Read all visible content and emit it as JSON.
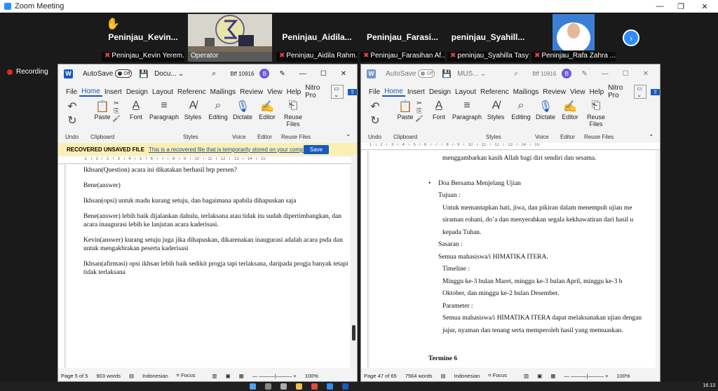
{
  "zoom": {
    "window_title": "Zoom Meeting",
    "recording_label": "Recording",
    "participants": [
      {
        "name": "Peninjau_Kevin...",
        "label": "Peninjau_Kevin Yerem...",
        "muted": true
      },
      {
        "name": "",
        "label": "Operator",
        "muted": false
      },
      {
        "name": "Peninjau_Aidila...",
        "label": "Peninjau_Aidila Rahm...",
        "muted": true
      },
      {
        "name": "Peninjau_Farasi...",
        "label": "Peninjau_Farasihan Af...",
        "muted": true
      },
      {
        "name": "peninjau_Syahill...",
        "label": "peninjau_Syahilla Tasya",
        "muted": true
      },
      {
        "name": "",
        "label": "Peninjau_Rafa Zahra ...",
        "muted": true
      }
    ],
    "next_glyph": "›"
  },
  "word_left": {
    "autosave": "AutoSave",
    "toggle": "Off",
    "doc_name": "Docu...",
    "account": "Bff 10916",
    "avatar": "B",
    "menu": [
      "File",
      "Home",
      "Insert",
      "Design",
      "Layout",
      "Referenc",
      "Mailings",
      "Review",
      "View",
      "Help",
      "Nitro Pro"
    ],
    "ribbon": {
      "paste": "Paste",
      "font": "Font",
      "paragraph": "Paragraph",
      "styles": "Styles",
      "editing": "Editing",
      "dictate": "Dictate",
      "editor": "Editor",
      "reuse": "Reuse Files"
    },
    "groups": [
      "Undo",
      "Clipboard",
      "Styles",
      "Voice",
      "Editor",
      "Reuse Files"
    ],
    "notice": {
      "title": "RECOVERED UNSAVED FILE",
      "text": "This is a recovered file that is temporarily stored on your computer.",
      "save": "Save"
    },
    "ruler": "· 1 · ı · 1 · ı · 2 · ı · 3 · ı · 4 · ı · 5 · ı · 6 · ı · 7 · ı · 8 · ı · 9 · ı · 10 · ı · 11 · ı · 12 · ı · 13 · ı · 14 · ı · 15 ·",
    "paragraphs": [
      "Ikhsan(Question) acara ini dikatakan berhasil brp persen?",
      "Bene(answer)",
      "Ikhsan(opsi) untuk madu kurang setuju, dan bagaimana apabila dihapuskan saja",
      "Bene(answer) lebih baik dijalankan dahulu, terlaksana atau tidak itu sudah dipertimbangkan, dan acara inaugurasi lebih ke lanjutan acara kaderisasi.",
      "Kevin(answer) kurang setuju juga jika dihapuskan, dikarenakan inaugurasi adalah acara psda dan untuk mengakbrakan peserta kaderisasi",
      "Ikhsan(afirmasi) opsi ikhsan lebih baik sedikit progja tapi terlaksana, daripada progja banyak tetapi tidak terlaksana"
    ],
    "status": {
      "page": "Page 5 of 5",
      "words": "903 words",
      "lang": "Indonesian",
      "focus": "Focus",
      "zoom": "100%"
    }
  },
  "word_right": {
    "autosave": "AutoSave",
    "toggle": "Off",
    "doc_name": "MUS...",
    "account": "Bff 10916",
    "avatar": "B",
    "menu": [
      "File",
      "Home",
      "Insert",
      "Design",
      "Layout",
      "Referenc",
      "Mailings",
      "Review",
      "View",
      "Help",
      "Nitro Pro"
    ],
    "ribbon": {
      "paste": "Paste",
      "font": "Font",
      "paragraph": "Paragraph",
      "styles": "Styles",
      "editing": "Editing",
      "dictate": "Dictate",
      "editor": "Editor",
      "reuse": "Reuse Files"
    },
    "groups": [
      "Undo",
      "Clipboard",
      "Styles",
      "Voice",
      "Editor",
      "Reuse Files"
    ],
    "ruler": "· 1 · ı · 2 · ı · 3 · ı · 4 · ı · 5 · ı · 6 · ı · 7 · ı · 8 · ı · 9 · ı · 10 · ı · 11 · ı · 12 · ı · 13 · ı · 14 · ı · 15 ·",
    "lines": [
      {
        "text": "menggambarkan kasih Allah bagi diri sendiri dan sesama.",
        "indent": 18
      },
      {
        "text": "Doa Bersama Menjelang Ujian",
        "indent": 12,
        "bullet": true
      },
      {
        "text": "Tujuan :",
        "indent": 12
      },
      {
        "text": "Untuk memantapkan hati, jiwa, dan pikiran dalam menempuh ujian me",
        "indent": 18
      },
      {
        "text": "siraman rohani, do’a dan menyerahkan segala kekhawatiran dari hasil u",
        "indent": 18
      },
      {
        "text": "kepada Tuhan.",
        "indent": 18
      },
      {
        "text": "Sasaran :",
        "indent": 12
      },
      {
        "text": "Semua mahasiswa/i HIMATIKA ITERA.",
        "indent": 12
      },
      {
        "text": "Timeline :",
        "indent": 18
      },
      {
        "text": "Minggu ke-3 bulan Maret, minggu ke-3 bulan April, minggu ke-3 b",
        "indent": 18
      },
      {
        "text": "Oktober, dan minggu ke-2 bulan Desember.",
        "indent": 18
      },
      {
        "text": "Parameter :",
        "indent": 18
      },
      {
        "text": "Semua mahasiswa/i HIMATIKA ITERA dapat melaksanakan ujian dengan",
        "indent": 18
      },
      {
        "text": "jujur, nyaman dan tenang serta memperoleh hasil yang memuaskan.",
        "indent": 18
      }
    ],
    "heading": "Termine 6",
    "status": {
      "page": "Page 47 of 65",
      "words": "7564 words",
      "lang": "Indonesian",
      "focus": "Focus",
      "zoom": "100%"
    }
  },
  "taskbar": {
    "time": "16.13"
  },
  "colors": {
    "zoom_blue": "#2d8cff",
    "word_blue": "#185abd",
    "recording_red": "#e02828",
    "mute_red": "#e64545"
  }
}
